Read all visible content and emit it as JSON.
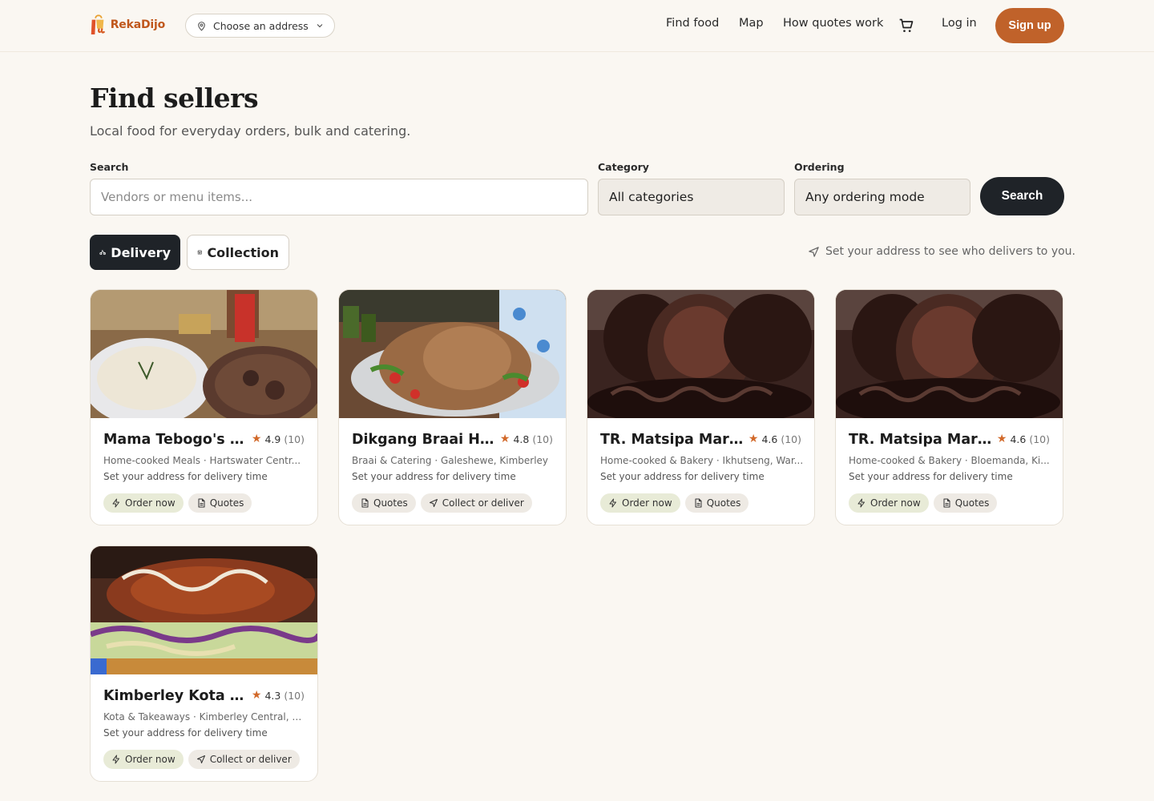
{
  "header": {
    "brand": "RekaDijo",
    "address_button": "Choose an address",
    "nav": [
      "Find food",
      "Map",
      "How quotes work"
    ],
    "login": "Log in",
    "signup": "Sign up"
  },
  "page": {
    "title": "Find sellers",
    "subtitle": "Local food for everyday orders, bulk and catering."
  },
  "filters": {
    "search_label": "Search",
    "search_placeholder": "Vendors or menu items...",
    "category_label": "Category",
    "category_value": "All categories",
    "ordering_label": "Ordering",
    "ordering_value": "Any ordering mode",
    "search_button": "Search"
  },
  "modes": {
    "delivery": "Delivery",
    "collection": "Collection",
    "hint": "Set your address to see who delivers to you."
  },
  "vendors": [
    {
      "name": "Mama Tebogo's K...",
      "rating": "4.9",
      "count": "(10)",
      "meta": "Home-cooked Meals · Hartswater Centr...",
      "delivery": "Set your address for delivery time",
      "chips": [
        "Order now",
        "Quotes"
      ]
    },
    {
      "name": "Dikgang Braai Ho...",
      "rating": "4.8",
      "count": "(10)",
      "meta": "Braai & Catering · Galeshewe, Kimberley",
      "delivery": "Set your address for delivery time",
      "chips": [
        "Quotes",
        "Collect or deliver"
      ]
    },
    {
      "name": "TR. Matsipa Market",
      "rating": "4.6",
      "count": "(10)",
      "meta": "Home-cooked & Bakery · Ikhutseng, War...",
      "delivery": "Set your address for delivery time",
      "chips": [
        "Order now",
        "Quotes"
      ]
    },
    {
      "name": "TR. Matsipa Market",
      "rating": "4.6",
      "count": "(10)",
      "meta": "Home-cooked & Bakery · Bloemanda, Ki...",
      "delivery": "Set your address for delivery time",
      "chips": [
        "Order now",
        "Quotes"
      ]
    },
    {
      "name": "Kimberley Kota Co...",
      "rating": "4.3",
      "count": "(10)",
      "meta": "Kota & Takeaways · Kimberley Central, Ki...",
      "delivery": "Set your address for delivery time",
      "chips": [
        "Order now",
        "Collect or deliver"
      ]
    }
  ],
  "colors": {
    "accent": "#c0622a",
    "dark": "#1f2328",
    "background": "#faf7f2"
  }
}
